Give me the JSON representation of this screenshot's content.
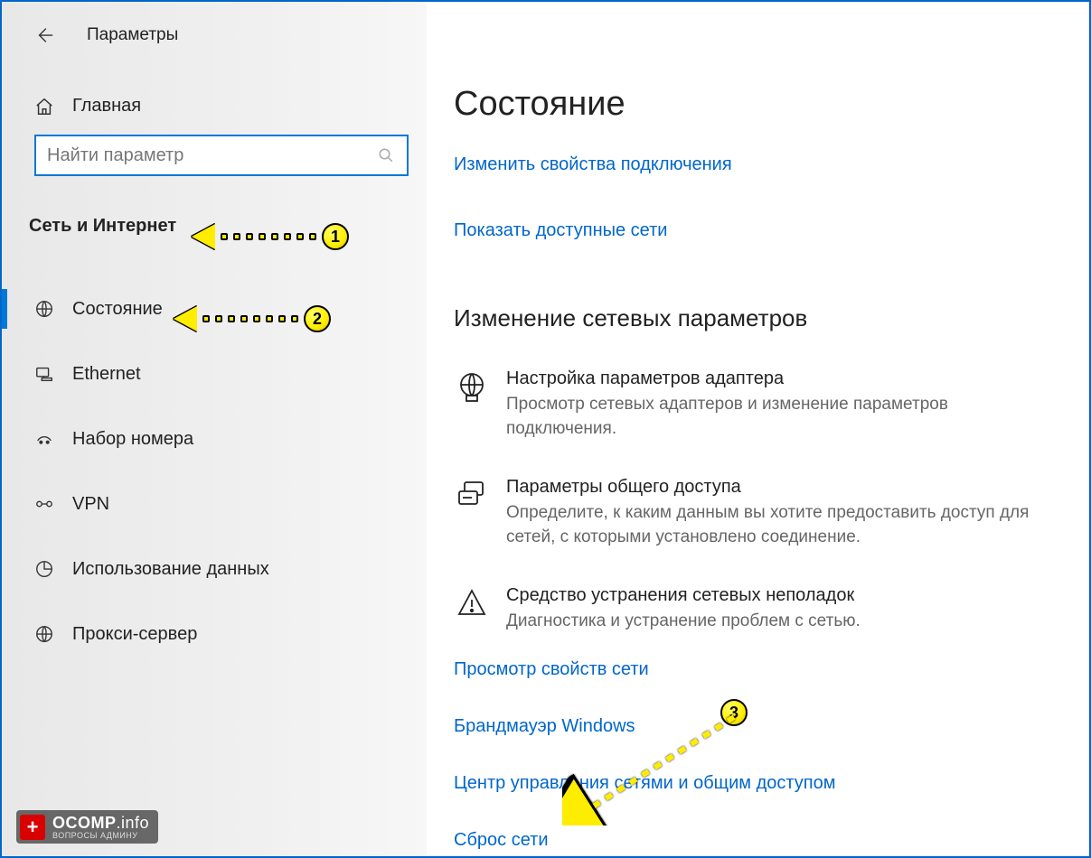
{
  "header": {
    "app_title": "Параметры"
  },
  "sidebar": {
    "home_label": "Главная",
    "search_placeholder": "Найти параметр",
    "section_title": "Сеть и Интернет",
    "items": [
      {
        "label": "Состояние",
        "icon": "globe-icon",
        "active": true
      },
      {
        "label": "Ethernet",
        "icon": "ethernet-icon",
        "active": false
      },
      {
        "label": "Набор номера",
        "icon": "dialup-icon",
        "active": false
      },
      {
        "label": "VPN",
        "icon": "vpn-icon",
        "active": false
      },
      {
        "label": "Использование данных",
        "icon": "data-usage-icon",
        "active": false
      },
      {
        "label": "Прокси-сервер",
        "icon": "proxy-icon",
        "active": false
      }
    ]
  },
  "main": {
    "title": "Состояние",
    "link_change_props": "Изменить свойства подключения",
    "link_show_networks": "Показать доступные сети",
    "subheader": "Изменение сетевых параметров",
    "options": [
      {
        "title": "Настройка параметров адаптера",
        "desc": "Просмотр сетевых адаптеров и изменение параметров подключения.",
        "icon": "adapter-icon"
      },
      {
        "title": "Параметры общего доступа",
        "desc": "Определите, к каким данным вы хотите предоставить доступ для сетей, с которыми установлено соединение.",
        "icon": "sharing-icon"
      },
      {
        "title": "Средство устранения сетевых неполадок",
        "desc": "Диагностика и устранение проблем с сетью.",
        "icon": "troubleshoot-icon"
      }
    ],
    "link_view_props": "Просмотр свойств сети",
    "link_firewall": "Брандмауэр Windows",
    "link_control_center": "Центр управления сетями и общим доступом",
    "link_reset": "Сброс сети"
  },
  "callouts": {
    "c1": "1",
    "c2": "2",
    "c3": "3"
  },
  "watermark": {
    "brand": "OCOMP",
    "suffix": ".info",
    "tagline": "ВОПРОСЫ АДМИНУ"
  }
}
